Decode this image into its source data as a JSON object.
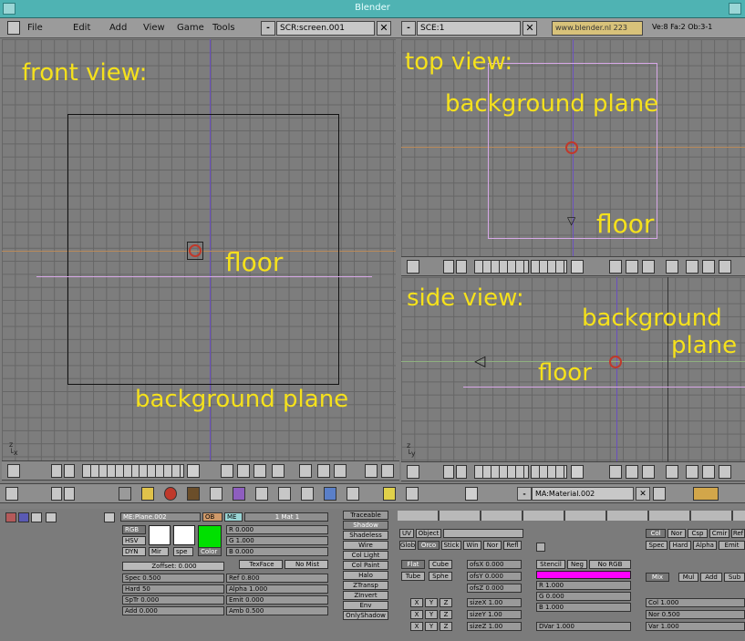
{
  "window": {
    "title": "Blender"
  },
  "menu": [
    "File",
    "Edit",
    "Add",
    "View",
    "Game",
    "Tools"
  ],
  "screen_field": "SCR:screen.001",
  "scene_field": "SCE:1",
  "website": "www.blender.nl",
  "version_num": "223",
  "stats": "Ve:8 Fa:2 Ob:3-1",
  "views": {
    "front": {
      "title": "front view:",
      "floor": "floor",
      "bg": "background plane"
    },
    "top": {
      "title": "top view:",
      "bg": "background plane",
      "floor": "floor"
    },
    "side": {
      "title": "side view:",
      "bg1": "background",
      "bg2": "plane",
      "floor": "floor"
    }
  },
  "material_header": {
    "name": "MA:Material.002"
  },
  "props": {
    "me_field": "ME:Plane.002",
    "ob_btn": "OB",
    "me_btn": "ME",
    "mat_field": "1 Mat 1",
    "rgb": "RGB",
    "hsv": "HSV",
    "dyn": "DYN",
    "mir": "Mir",
    "spec": "spe",
    "color": "Color",
    "r": "R 0.000",
    "g": "G 1.000",
    "b": "B 0.000",
    "zoffset": "Zoffset: 0.000",
    "texface": "TexFace",
    "nomist": "No Mist",
    "sliders_left": [
      "Spec 0.500",
      "Hard 50",
      "SpTr 0.000",
      "Add 0.000"
    ],
    "sliders_mid": [
      "Ref  0.800",
      "Alpha 1.000",
      "Emit  0.000",
      "Amb  0.500"
    ],
    "toggles": [
      "Traceable",
      "Shadow",
      "Shadeless",
      "Wire",
      "Col Light",
      "Col Paint",
      "Halo",
      "ZTransp",
      "ZInvert",
      "Env",
      "OnlyShadow"
    ],
    "mapping_top": [
      "UV",
      "Object",
      "Glob",
      "Orco",
      "Stick",
      "Win",
      "Nor",
      "Refl"
    ],
    "flat": "Flat",
    "cube": "Cube",
    "tube": "Tube",
    "sphe": "Sphe",
    "ofs": [
      "ofsX 0.000",
      "ofsY 0.000",
      "ofsZ 0.000"
    ],
    "size": [
      "sizeX 1.00",
      "sizeY 1.00",
      "sizeZ 1.00"
    ],
    "xyz": [
      "X",
      "Y",
      "Z"
    ],
    "stencil": "Stencil",
    "neg": "Neg",
    "norgb": "No RGB",
    "tr": "R 1.000",
    "tg": "G 0.000",
    "tb": "B 1.000",
    "dvar": "DVar 1.000",
    "right_top": [
      "Col",
      "Nor",
      "Csp",
      "Cmir",
      "Ref"
    ],
    "right_mid": [
      "Spec",
      "Hard",
      "Alpha",
      "Emit"
    ],
    "blend": [
      "Mix",
      "Mul",
      "Add",
      "Sub"
    ],
    "right_sliders": [
      "Col 1.000",
      "Nor 0.500",
      "Var 1.000"
    ]
  }
}
